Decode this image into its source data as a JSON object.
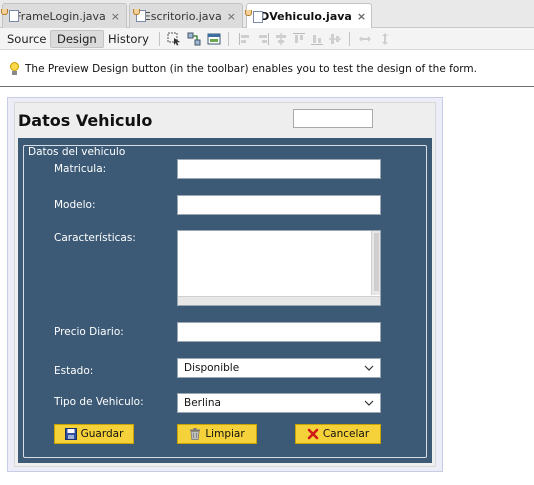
{
  "tabs": [
    {
      "label": "JFrameLogin.java",
      "active": false
    },
    {
      "label": "Escritorio.java",
      "active": false
    },
    {
      "label": "JDVehiculo.java",
      "active": true
    }
  ],
  "close_glyph": "×",
  "view_buttons": {
    "source": "Source",
    "design": "Design",
    "history": "History"
  },
  "toolbar_icons": [
    "selection-mode-icon",
    "connection-mode-icon",
    "preview-design-icon",
    "align-left-icon",
    "align-right-icon",
    "center-horizontal-icon",
    "align-top-icon",
    "align-bottom-icon",
    "center-vertical-icon",
    "same-width-icon",
    "same-height-icon"
  ],
  "info_message": "The Preview Design button (in the toolbar) enables you to test the design of the form.",
  "form": {
    "title": "Datos Vehiculo",
    "group_label": "Datos del vehiculo",
    "fields": {
      "matricula": {
        "label": "Matricula:",
        "value": ""
      },
      "modelo": {
        "label": "Modelo:",
        "value": ""
      },
      "caracteristicas": {
        "label": "Características:",
        "value": ""
      },
      "precio": {
        "label": "Precio Diario:",
        "value": ""
      },
      "estado": {
        "label": "Estado:",
        "selected": "Disponible"
      },
      "tipo": {
        "label": "Tipo de Vehiculo:",
        "selected": "Berlina"
      }
    },
    "buttons": {
      "guardar": "Guardar",
      "limpiar": "Limpiar",
      "cancelar": "Cancelar"
    }
  },
  "colors": {
    "panel_bg": "#3c5a76",
    "button_bg": "#f5d23a",
    "form_bg": "#eeeeee"
  }
}
